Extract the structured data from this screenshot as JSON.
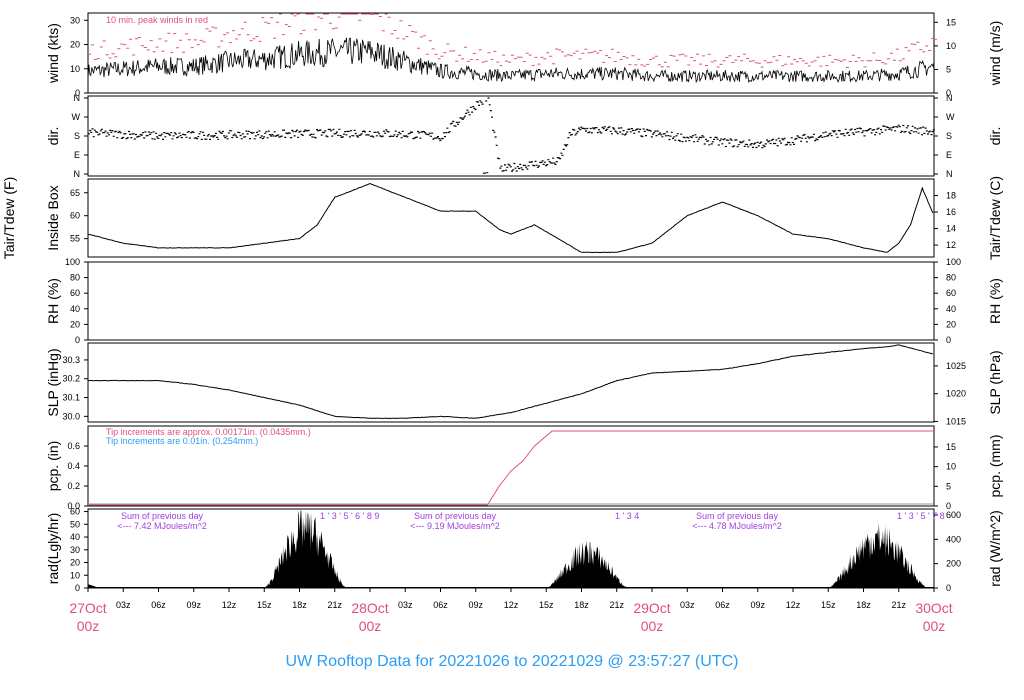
{
  "title": "UW Rooftop Data for 20221026  to  20221029 @ 23:57:27  (UTC)",
  "chart_data": [
    {
      "type": "line",
      "name": "wind",
      "ylabel_left": "wind (kts)",
      "ylabel_right": "wind (m/s)",
      "ylim": [
        0,
        33
      ],
      "left_ticks": [
        0,
        10,
        20,
        30
      ],
      "right_ticks": [
        0,
        5,
        10,
        15
      ],
      "right_factor": 1.944,
      "annotation": "10 min. peak winds in red",
      "hours": [
        0,
        3,
        6,
        9,
        12,
        15,
        18,
        21,
        24,
        27,
        30,
        33,
        36,
        39,
        42,
        45,
        48,
        51,
        54,
        57,
        60,
        63,
        66,
        69,
        72
      ],
      "values": [
        9,
        10,
        11,
        11,
        13,
        14,
        16,
        17,
        17,
        13,
        9,
        8,
        7,
        8,
        8,
        8,
        7,
        7,
        7,
        7,
        7,
        7,
        7,
        8,
        11
      ]
    },
    {
      "type": "scatter",
      "name": "dir",
      "ylabel_left": "dir.",
      "ylabel_right": "dir.",
      "ylim": [
        0,
        360
      ],
      "tick_labels": [
        "N",
        "E",
        "S",
        "W",
        "N"
      ],
      "hours": [
        0,
        6,
        12,
        18,
        24,
        28,
        30,
        31,
        33,
        34,
        35,
        37,
        40,
        41,
        42,
        45,
        48,
        51,
        54,
        57,
        60,
        63,
        66,
        69,
        72
      ],
      "values": [
        195,
        180,
        185,
        190,
        195,
        185,
        175,
        230,
        330,
        360,
        20,
        40,
        60,
        190,
        210,
        205,
        190,
        170,
        150,
        140,
        160,
        190,
        200,
        215,
        200
      ]
    },
    {
      "type": "line",
      "name": "temperature",
      "ylabel_left": "Tair/Tdew (F)",
      "ylabel_left2": "Inside Box",
      "ylabel_right": "Tair/Tdew (C)",
      "ylim": [
        51,
        68
      ],
      "left_ticks": [
        55,
        60,
        65
      ],
      "right_ticks": [
        12,
        14,
        16,
        18
      ],
      "hours": [
        0,
        3,
        6,
        9,
        12,
        15,
        18,
        19.5,
        21,
        24,
        27,
        30,
        33,
        35,
        36,
        38,
        40,
        42,
        45,
        48,
        51,
        54,
        57,
        60,
        63,
        66,
        68,
        69,
        70,
        71,
        72
      ],
      "values": [
        56,
        54,
        53,
        53,
        53,
        54,
        55,
        58,
        64,
        67,
        64,
        61,
        61,
        57,
        56,
        58,
        55,
        52,
        52,
        54,
        60,
        63,
        60,
        56,
        55,
        53,
        52,
        54,
        58,
        66,
        60
      ]
    },
    {
      "type": "line",
      "name": "rh",
      "ylabel_left": "RH (%)",
      "ylabel_right": "RH (%)",
      "ylim": [
        0,
        100
      ],
      "left_ticks": [
        0,
        20,
        40,
        60,
        80,
        100
      ],
      "right_ticks": [
        0,
        20,
        40,
        60,
        80,
        100
      ],
      "hours": [],
      "values": []
    },
    {
      "type": "line",
      "name": "slp",
      "ylabel_left": "SLP (inHg)",
      "ylabel_right": "SLP (hPa)",
      "ylim": [
        29.97,
        30.39
      ],
      "left_ticks": [
        "30.0",
        "30.1",
        "30.2",
        "30.3"
      ],
      "right_ticks": [
        1015,
        1020,
        1025
      ],
      "hours": [
        0,
        6,
        9,
        12,
        15,
        18,
        21,
        24,
        27,
        30,
        33,
        36,
        39,
        42,
        45,
        48,
        51,
        54,
        57,
        60,
        63,
        66,
        68,
        69,
        72
      ],
      "values": [
        30.19,
        30.19,
        30.17,
        30.14,
        30.1,
        30.06,
        30.0,
        29.99,
        29.99,
        30.0,
        29.99,
        30.02,
        30.07,
        30.12,
        30.19,
        30.23,
        30.24,
        30.25,
        30.28,
        30.32,
        30.34,
        30.36,
        30.37,
        30.38,
        30.33
      ]
    },
    {
      "type": "line",
      "name": "pcp",
      "ylabel_left": "pcp. (in)",
      "ylabel_right": "pcp. (mm)",
      "ylim": [
        0,
        0.8
      ],
      "left_ticks": [
        "0.0",
        "0.2",
        "0.4",
        "0.6"
      ],
      "right_ticks": [
        0,
        5,
        10,
        15
      ],
      "annotations": [
        "Tip increments are approx. 0.00171in. (0.0435mm.)",
        "Tip increments are 0.01in. (0.254mm.)"
      ],
      "hours": [
        0,
        30,
        34,
        35,
        36,
        37,
        38,
        39.5,
        72
      ],
      "values": [
        0,
        0.01,
        0.01,
        0.2,
        0.35,
        0.45,
        0.6,
        0.75,
        0.75
      ]
    },
    {
      "type": "area",
      "name": "radiation",
      "ylabel_left": "rad(Lgly/hr)",
      "ylabel_right": "rad (W/m^2)",
      "ylim": [
        0,
        62
      ],
      "left_ticks": [
        0,
        10,
        20,
        30,
        40,
        50,
        60
      ],
      "right_ticks": [
        0,
        200,
        400,
        600
      ],
      "days": [
        {
          "start": 15,
          "peak_hour": 19.5,
          "end": 22,
          "peak": 58
        },
        {
          "start": 39,
          "peak_hour": 43.5,
          "end": 46,
          "peak": 35
        },
        {
          "start": 63,
          "peak_hour": 67.5,
          "end": 71.5,
          "peak": 48
        }
      ],
      "day_sums": [
        {
          "label1": "Sum of previous day",
          "label2": "<--- 7.42 MJoules/m^2",
          "hour_marks": "1 ' 3 ' 5 ' 6 ' 8   9"
        },
        {
          "label1": "Sum of previous day",
          "label2": "<--- 9.19 MJoules/m^2",
          "hour_marks": "1  '  3   4"
        },
        {
          "label1": "Sum of previous day",
          "label2": "<--- 4.78 MJoules/m^2",
          "hour_marks": "1 ' 3 ' 5 ' 7  8"
        }
      ]
    }
  ],
  "x_axis": {
    "hour_labels": [
      "03z",
      "06z",
      "09z",
      "12z",
      "15z",
      "18z",
      "21z"
    ],
    "day_labels": [
      "27Oct",
      "28Oct",
      "29Oct",
      "30Oct"
    ],
    "day_sub": "00z"
  }
}
